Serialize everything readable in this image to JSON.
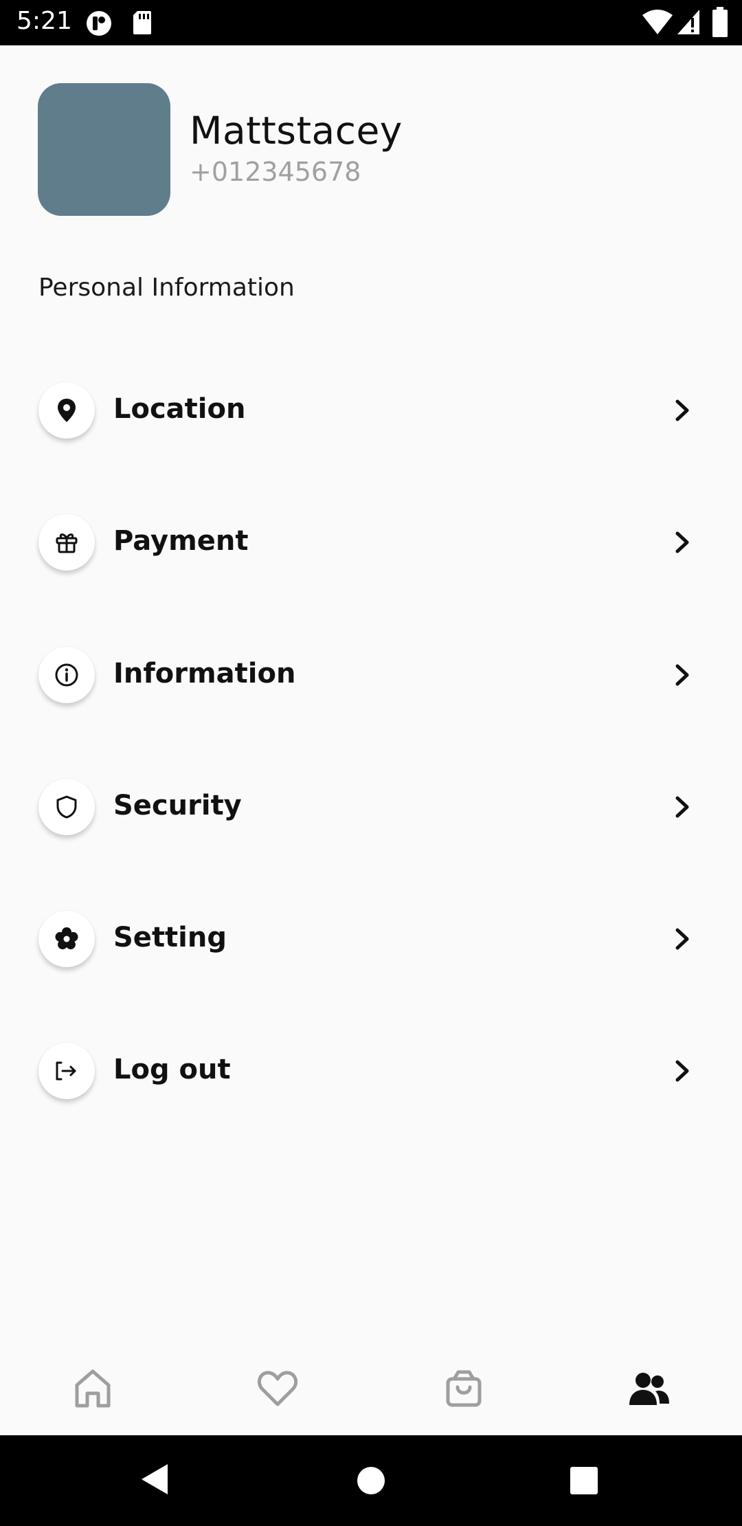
{
  "status_bar": {
    "time": "5:21",
    "left_icons": [
      "app-notification-icon",
      "sd-card-icon"
    ],
    "right_icons": [
      "wifi-icon",
      "cellular-signal-icon",
      "battery-icon"
    ]
  },
  "profile": {
    "name": "Mattstacey",
    "phone": "+012345678",
    "avatar_color": "#607d8b"
  },
  "section_title": "Personal Information",
  "menu": [
    {
      "label": "Location",
      "icon": "location-pin-icon"
    },
    {
      "label": "Payment",
      "icon": "gift-icon"
    },
    {
      "label": "Information",
      "icon": "info-icon"
    },
    {
      "label": "Security",
      "icon": "shield-icon"
    },
    {
      "label": "Setting",
      "icon": "gear-icon"
    },
    {
      "label": "Log out",
      "icon": "logout-icon"
    }
  ],
  "bottom_nav": {
    "items": [
      {
        "icon": "home-icon",
        "active": false
      },
      {
        "icon": "heart-icon",
        "active": false
      },
      {
        "icon": "shopping-bag-icon",
        "active": false
      },
      {
        "icon": "people-icon",
        "active": true
      }
    ],
    "active_color": "#111111",
    "inactive_color": "#9e9e9e"
  },
  "system_nav": [
    "back-icon",
    "home-circle-icon",
    "recents-icon"
  ]
}
